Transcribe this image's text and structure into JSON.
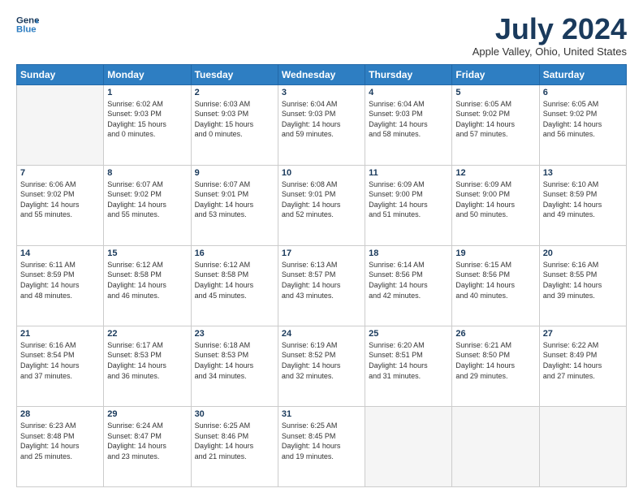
{
  "header": {
    "logo_line1": "General",
    "logo_line2": "Blue",
    "month_title": "July 2024",
    "location": "Apple Valley, Ohio, United States"
  },
  "weekdays": [
    "Sunday",
    "Monday",
    "Tuesday",
    "Wednesday",
    "Thursday",
    "Friday",
    "Saturday"
  ],
  "weeks": [
    [
      {
        "day": "",
        "info": ""
      },
      {
        "day": "1",
        "info": "Sunrise: 6:02 AM\nSunset: 9:03 PM\nDaylight: 15 hours\nand 0 minutes."
      },
      {
        "day": "2",
        "info": "Sunrise: 6:03 AM\nSunset: 9:03 PM\nDaylight: 15 hours\nand 0 minutes."
      },
      {
        "day": "3",
        "info": "Sunrise: 6:04 AM\nSunset: 9:03 PM\nDaylight: 14 hours\nand 59 minutes."
      },
      {
        "day": "4",
        "info": "Sunrise: 6:04 AM\nSunset: 9:03 PM\nDaylight: 14 hours\nand 58 minutes."
      },
      {
        "day": "5",
        "info": "Sunrise: 6:05 AM\nSunset: 9:02 PM\nDaylight: 14 hours\nand 57 minutes."
      },
      {
        "day": "6",
        "info": "Sunrise: 6:05 AM\nSunset: 9:02 PM\nDaylight: 14 hours\nand 56 minutes."
      }
    ],
    [
      {
        "day": "7",
        "info": "Sunrise: 6:06 AM\nSunset: 9:02 PM\nDaylight: 14 hours\nand 55 minutes."
      },
      {
        "day": "8",
        "info": "Sunrise: 6:07 AM\nSunset: 9:02 PM\nDaylight: 14 hours\nand 55 minutes."
      },
      {
        "day": "9",
        "info": "Sunrise: 6:07 AM\nSunset: 9:01 PM\nDaylight: 14 hours\nand 53 minutes."
      },
      {
        "day": "10",
        "info": "Sunrise: 6:08 AM\nSunset: 9:01 PM\nDaylight: 14 hours\nand 52 minutes."
      },
      {
        "day": "11",
        "info": "Sunrise: 6:09 AM\nSunset: 9:00 PM\nDaylight: 14 hours\nand 51 minutes."
      },
      {
        "day": "12",
        "info": "Sunrise: 6:09 AM\nSunset: 9:00 PM\nDaylight: 14 hours\nand 50 minutes."
      },
      {
        "day": "13",
        "info": "Sunrise: 6:10 AM\nSunset: 8:59 PM\nDaylight: 14 hours\nand 49 minutes."
      }
    ],
    [
      {
        "day": "14",
        "info": "Sunrise: 6:11 AM\nSunset: 8:59 PM\nDaylight: 14 hours\nand 48 minutes."
      },
      {
        "day": "15",
        "info": "Sunrise: 6:12 AM\nSunset: 8:58 PM\nDaylight: 14 hours\nand 46 minutes."
      },
      {
        "day": "16",
        "info": "Sunrise: 6:12 AM\nSunset: 8:58 PM\nDaylight: 14 hours\nand 45 minutes."
      },
      {
        "day": "17",
        "info": "Sunrise: 6:13 AM\nSunset: 8:57 PM\nDaylight: 14 hours\nand 43 minutes."
      },
      {
        "day": "18",
        "info": "Sunrise: 6:14 AM\nSunset: 8:56 PM\nDaylight: 14 hours\nand 42 minutes."
      },
      {
        "day": "19",
        "info": "Sunrise: 6:15 AM\nSunset: 8:56 PM\nDaylight: 14 hours\nand 40 minutes."
      },
      {
        "day": "20",
        "info": "Sunrise: 6:16 AM\nSunset: 8:55 PM\nDaylight: 14 hours\nand 39 minutes."
      }
    ],
    [
      {
        "day": "21",
        "info": "Sunrise: 6:16 AM\nSunset: 8:54 PM\nDaylight: 14 hours\nand 37 minutes."
      },
      {
        "day": "22",
        "info": "Sunrise: 6:17 AM\nSunset: 8:53 PM\nDaylight: 14 hours\nand 36 minutes."
      },
      {
        "day": "23",
        "info": "Sunrise: 6:18 AM\nSunset: 8:53 PM\nDaylight: 14 hours\nand 34 minutes."
      },
      {
        "day": "24",
        "info": "Sunrise: 6:19 AM\nSunset: 8:52 PM\nDaylight: 14 hours\nand 32 minutes."
      },
      {
        "day": "25",
        "info": "Sunrise: 6:20 AM\nSunset: 8:51 PM\nDaylight: 14 hours\nand 31 minutes."
      },
      {
        "day": "26",
        "info": "Sunrise: 6:21 AM\nSunset: 8:50 PM\nDaylight: 14 hours\nand 29 minutes."
      },
      {
        "day": "27",
        "info": "Sunrise: 6:22 AM\nSunset: 8:49 PM\nDaylight: 14 hours\nand 27 minutes."
      }
    ],
    [
      {
        "day": "28",
        "info": "Sunrise: 6:23 AM\nSunset: 8:48 PM\nDaylight: 14 hours\nand 25 minutes."
      },
      {
        "day": "29",
        "info": "Sunrise: 6:24 AM\nSunset: 8:47 PM\nDaylight: 14 hours\nand 23 minutes."
      },
      {
        "day": "30",
        "info": "Sunrise: 6:25 AM\nSunset: 8:46 PM\nDaylight: 14 hours\nand 21 minutes."
      },
      {
        "day": "31",
        "info": "Sunrise: 6:25 AM\nSunset: 8:45 PM\nDaylight: 14 hours\nand 19 minutes."
      },
      {
        "day": "",
        "info": ""
      },
      {
        "day": "",
        "info": ""
      },
      {
        "day": "",
        "info": ""
      }
    ]
  ]
}
